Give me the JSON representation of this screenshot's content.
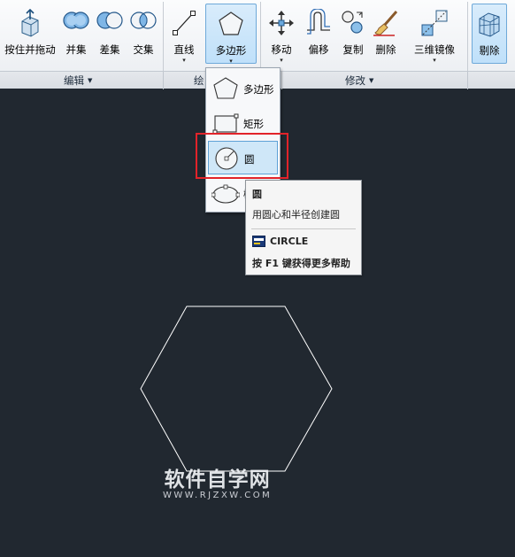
{
  "ribbon": {
    "tools": [
      {
        "label": "按住并拖动",
        "icon": "presspull-icon"
      },
      {
        "label": "并集",
        "icon": "union-icon"
      },
      {
        "label": "差集",
        "icon": "subtract-icon"
      },
      {
        "label": "交集",
        "icon": "intersect-icon"
      },
      {
        "label": "直线",
        "icon": "line-icon"
      },
      {
        "label": "多边形",
        "icon": "polygon-icon"
      },
      {
        "label": "移动",
        "icon": "move-icon"
      },
      {
        "label": "偏移",
        "icon": "offset-icon"
      },
      {
        "label": "复制",
        "icon": "copy-icon"
      },
      {
        "label": "删除",
        "icon": "erase-icon"
      },
      {
        "label": "三维镜像",
        "icon": "mirror3d-icon"
      },
      {
        "label": "剔除",
        "icon": "cull-icon"
      }
    ],
    "arrow": "▾",
    "panels": {
      "edit": "编辑",
      "draw": "绘",
      "modify": "修改",
      "tri": "▼"
    }
  },
  "dropdown": {
    "items": [
      {
        "label": "多边形",
        "icon": "polygon-icon"
      },
      {
        "label": "矩形",
        "icon": "rectangle-icon"
      },
      {
        "label": "圆",
        "icon": "circle-icon"
      },
      {
        "label": "椭",
        "icon": "ellipse-icon"
      }
    ],
    "selected_index": 2
  },
  "tooltip": {
    "title": "圆",
    "description": "用圆心和半径创建圆",
    "command": "CIRCLE",
    "help": "按 F1 键获得更多帮助"
  },
  "watermark": {
    "line1": "软件自学网",
    "line2": "WWW.RJZXW.COM"
  },
  "colors": {
    "canvas": "#212830",
    "accent": "#5ea1d6",
    "highlight_box": "#e2232a"
  }
}
